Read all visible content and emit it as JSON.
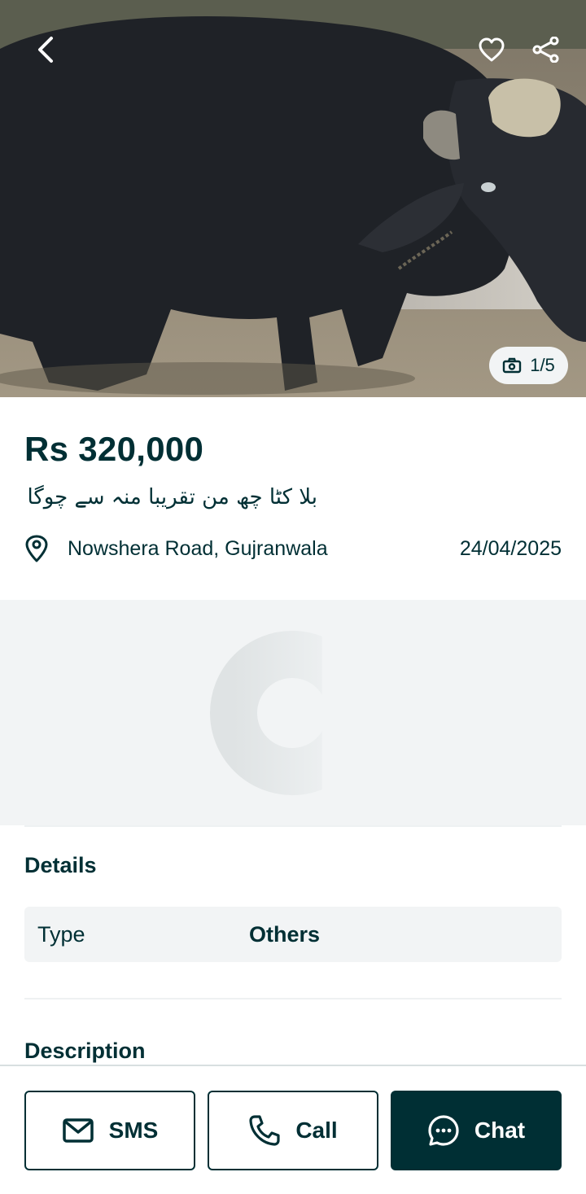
{
  "hero": {
    "image_counter": "1/5",
    "icons": {
      "back": "chevron-left-icon",
      "favorite": "heart-icon",
      "share": "share-icon",
      "camera": "camera-icon"
    }
  },
  "listing": {
    "price": "Rs 320,000",
    "title": "بلا کٹا چھ من تقریبا منہ سے چوگا",
    "location": "Nowshera Road, Gujranwala",
    "date": "24/04/2025"
  },
  "details": {
    "heading": "Details",
    "rows": [
      {
        "key": "Type",
        "value": "Others"
      }
    ]
  },
  "description": {
    "heading": "Description"
  },
  "actions": {
    "sms": "SMS",
    "call": "Call",
    "chat": "Chat"
  },
  "colors": {
    "primary": "#002f34",
    "placeholder_bg": "#f2f4f5",
    "white": "#ffffff"
  }
}
